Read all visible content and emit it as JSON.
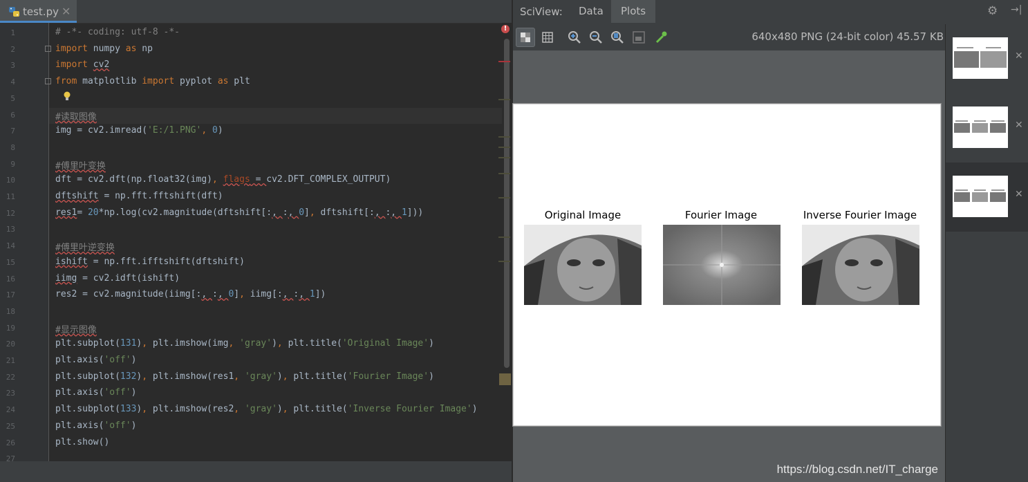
{
  "editor": {
    "tab": {
      "filename": "test.py",
      "close": "✕"
    },
    "lines": [
      {
        "num": "1",
        "segs": [
          {
            "t": "# -*- coding: utf-8 -*-",
            "c": "cm"
          }
        ]
      },
      {
        "num": "2",
        "segs": [
          {
            "t": "import",
            "c": "kw"
          },
          {
            "t": " numpy ",
            "c": ""
          },
          {
            "t": "as",
            "c": "kw"
          },
          {
            "t": " np",
            "c": ""
          }
        ]
      },
      {
        "num": "3",
        "segs": [
          {
            "t": "import",
            "c": "kw"
          },
          {
            "t": " ",
            "c": ""
          },
          {
            "t": "cv2",
            "c": "wv"
          }
        ]
      },
      {
        "num": "4",
        "segs": [
          {
            "t": "from",
            "c": "kw"
          },
          {
            "t": " matplotlib ",
            "c": ""
          },
          {
            "t": "import",
            "c": "kw"
          },
          {
            "t": " pyplot ",
            "c": ""
          },
          {
            "t": "as",
            "c": "kw"
          },
          {
            "t": " plt",
            "c": ""
          }
        ]
      },
      {
        "num": "5",
        "segs": []
      },
      {
        "num": "6",
        "segs": [
          {
            "t": "#读取图像",
            "c": "cm wv"
          }
        ]
      },
      {
        "num": "7",
        "segs": [
          {
            "t": "img = cv2.imread(",
            "c": ""
          },
          {
            "t": "'E:/1.PNG'",
            "c": "st"
          },
          {
            "t": ", ",
            "c": "kw"
          },
          {
            "t": "0",
            "c": "nm"
          },
          {
            "t": ")",
            "c": ""
          }
        ]
      },
      {
        "num": "8",
        "segs": []
      },
      {
        "num": "9",
        "segs": [
          {
            "t": "#傅里叶变换",
            "c": "cm wv"
          }
        ]
      },
      {
        "num": "10",
        "segs": [
          {
            "t": "dft = cv2.dft(np.float32(img)",
            "c": ""
          },
          {
            "t": ", ",
            "c": "kw"
          },
          {
            "t": "flags",
            "c": "pm wv"
          },
          {
            "t": " = ",
            "c": "wv"
          },
          {
            "t": "cv2.DFT_COMPLEX_OUTPUT)",
            "c": ""
          }
        ]
      },
      {
        "num": "11",
        "segs": [
          {
            "t": "dftshift",
            "c": "wv"
          },
          {
            "t": " = np.fft.fftshift(dft)",
            "c": ""
          }
        ]
      },
      {
        "num": "12",
        "segs": [
          {
            "t": "res1",
            "c": "wv"
          },
          {
            "t": "= ",
            "c": ""
          },
          {
            "t": "20",
            "c": "nm"
          },
          {
            "t": "*np.log(cv2.magnitude(dftshift[:",
            "c": ""
          },
          {
            "t": ", ",
            "c": "wv"
          },
          {
            "t": ":",
            "c": ""
          },
          {
            "t": ", ",
            "c": "wv"
          },
          {
            "t": "0",
            "c": "nm"
          },
          {
            "t": "]",
            "c": ""
          },
          {
            "t": ", ",
            "c": "kw"
          },
          {
            "t": "dftshift[:",
            "c": ""
          },
          {
            "t": ", ",
            "c": "wv"
          },
          {
            "t": ":",
            "c": ""
          },
          {
            "t": ", ",
            "c": "wv"
          },
          {
            "t": "1",
            "c": "nm"
          },
          {
            "t": "]))",
            "c": ""
          }
        ]
      },
      {
        "num": "13",
        "segs": []
      },
      {
        "num": "14",
        "segs": [
          {
            "t": "#傅里叶逆变换",
            "c": "cm wv"
          }
        ]
      },
      {
        "num": "15",
        "segs": [
          {
            "t": "ishift",
            "c": "wv"
          },
          {
            "t": " = np.fft.ifftshift(dftshift)",
            "c": ""
          }
        ]
      },
      {
        "num": "16",
        "segs": [
          {
            "t": "iimg",
            "c": "wv"
          },
          {
            "t": " = cv2.idft(ishift)",
            "c": ""
          }
        ]
      },
      {
        "num": "17",
        "segs": [
          {
            "t": "res2 = cv2.magnitude(iimg[:",
            "c": ""
          },
          {
            "t": ", ",
            "c": "wv"
          },
          {
            "t": ":",
            "c": ""
          },
          {
            "t": ", ",
            "c": "wv"
          },
          {
            "t": "0",
            "c": "nm"
          },
          {
            "t": "]",
            "c": ""
          },
          {
            "t": ", ",
            "c": "kw"
          },
          {
            "t": "iimg[:",
            "c": ""
          },
          {
            "t": ", ",
            "c": "wv"
          },
          {
            "t": ":",
            "c": ""
          },
          {
            "t": ", ",
            "c": "wv"
          },
          {
            "t": "1",
            "c": "nm"
          },
          {
            "t": "])",
            "c": ""
          }
        ]
      },
      {
        "num": "18",
        "segs": []
      },
      {
        "num": "19",
        "segs": [
          {
            "t": "#显示图像",
            "c": "cm wv"
          }
        ]
      },
      {
        "num": "20",
        "segs": [
          {
            "t": "plt.subplot(",
            "c": ""
          },
          {
            "t": "131",
            "c": "nm"
          },
          {
            "t": ")",
            "c": ""
          },
          {
            "t": ", ",
            "c": "kw"
          },
          {
            "t": "plt.imshow(img",
            "c": ""
          },
          {
            "t": ", ",
            "c": "kw"
          },
          {
            "t": "'gray'",
            "c": "st"
          },
          {
            "t": ")",
            "c": ""
          },
          {
            "t": ", ",
            "c": "kw"
          },
          {
            "t": "plt.title(",
            "c": ""
          },
          {
            "t": "'Original Image'",
            "c": "st"
          },
          {
            "t": ")",
            "c": ""
          }
        ]
      },
      {
        "num": "21",
        "segs": [
          {
            "t": "plt.axis(",
            "c": ""
          },
          {
            "t": "'off'",
            "c": "st"
          },
          {
            "t": ")",
            "c": ""
          }
        ]
      },
      {
        "num": "22",
        "segs": [
          {
            "t": "plt.subplot(",
            "c": ""
          },
          {
            "t": "132",
            "c": "nm"
          },
          {
            "t": ")",
            "c": ""
          },
          {
            "t": ", ",
            "c": "kw"
          },
          {
            "t": "plt.imshow(res1",
            "c": ""
          },
          {
            "t": ", ",
            "c": "kw"
          },
          {
            "t": "'gray'",
            "c": "st"
          },
          {
            "t": ")",
            "c": ""
          },
          {
            "t": ", ",
            "c": "kw"
          },
          {
            "t": "plt.title(",
            "c": ""
          },
          {
            "t": "'Fourier Image'",
            "c": "st"
          },
          {
            "t": ")",
            "c": ""
          }
        ]
      },
      {
        "num": "23",
        "segs": [
          {
            "t": "plt.axis(",
            "c": ""
          },
          {
            "t": "'off'",
            "c": "st"
          },
          {
            "t": ")",
            "c": ""
          }
        ]
      },
      {
        "num": "24",
        "segs": [
          {
            "t": "plt.subplot(",
            "c": ""
          },
          {
            "t": "133",
            "c": "nm"
          },
          {
            "t": ")",
            "c": ""
          },
          {
            "t": ", ",
            "c": "kw"
          },
          {
            "t": "plt.imshow(res2",
            "c": ""
          },
          {
            "t": ", ",
            "c": "kw"
          },
          {
            "t": "'gray'",
            "c": "st"
          },
          {
            "t": ")",
            "c": ""
          },
          {
            "t": ", ",
            "c": "kw"
          },
          {
            "t": "plt.title(",
            "c": ""
          },
          {
            "t": "'Inverse Fourier Image'",
            "c": "st"
          },
          {
            "t": ")",
            "c": ""
          }
        ]
      },
      {
        "num": "25",
        "segs": [
          {
            "t": "plt.axis(",
            "c": ""
          },
          {
            "t": "'off'",
            "c": "st"
          },
          {
            "t": ")",
            "c": ""
          }
        ]
      },
      {
        "num": "26",
        "segs": [
          {
            "t": "plt.show()",
            "c": ""
          }
        ]
      },
      {
        "num": "27",
        "segs": []
      }
    ],
    "error_marker": "!"
  },
  "sciview": {
    "title": "SciView:",
    "tabs": [
      {
        "label": "Data"
      },
      {
        "label": "Plots"
      }
    ],
    "active_tab": "Plots",
    "toolbar_icons": [
      "chessboard-icon",
      "grid-icon",
      "zoom-in-icon",
      "zoom-out-icon",
      "actual-size-icon",
      "fit-icon",
      "color-picker-icon"
    ],
    "image_info": "640x480 PNG (24-bit color) 45.57 KB",
    "plot": {
      "subplots": [
        {
          "title": "Original Image"
        },
        {
          "title": "Fourier Image"
        },
        {
          "title": "Inverse Fourier Image"
        }
      ]
    },
    "thumbnails": [
      {
        "close": "✕"
      },
      {
        "close": "✕"
      },
      {
        "close": "✕"
      }
    ],
    "gear": "⚙",
    "collapse": "→|"
  },
  "watermark": "https://blog.csdn.net/IT_charge",
  "colors": {
    "bg": "#2b2b2b",
    "keyword": "#cc7832",
    "comment": "#808080",
    "string": "#6a8759",
    "number": "#6897bb",
    "param": "#aa4926",
    "text": "#a9b7c6",
    "tab_accent": "#4a88c7"
  }
}
